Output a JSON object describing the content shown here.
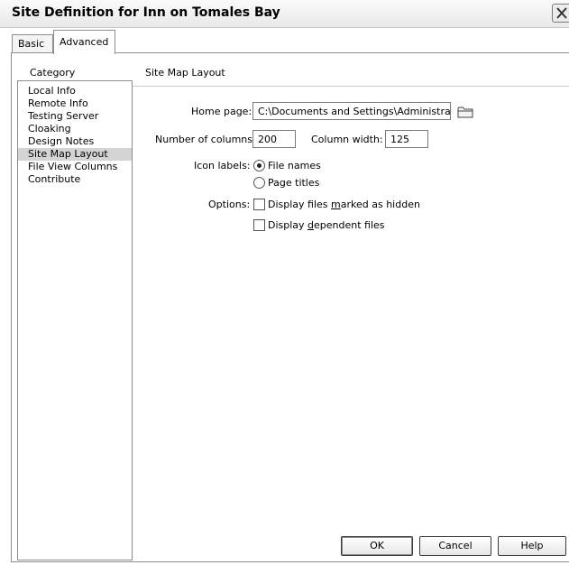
{
  "window": {
    "title": "Site Definition for Inn on Tomales Bay",
    "close_icon": "close-icon"
  },
  "tabs": [
    {
      "label": "Basic",
      "active": false
    },
    {
      "label": "Advanced",
      "active": true
    }
  ],
  "category": {
    "heading": "Category",
    "items": [
      {
        "label": "Local Info",
        "selected": false
      },
      {
        "label": "Remote Info",
        "selected": false
      },
      {
        "label": "Testing Server",
        "selected": false
      },
      {
        "label": "Cloaking",
        "selected": false
      },
      {
        "label": "Design Notes",
        "selected": false
      },
      {
        "label": "Site Map Layout",
        "selected": true
      },
      {
        "label": "File View Columns",
        "selected": false
      },
      {
        "label": "Contribute",
        "selected": false
      }
    ]
  },
  "section": {
    "heading": "Site Map Layout"
  },
  "form": {
    "home_page_label": "Home page:",
    "home_page_value": "C:\\Documents and Settings\\Administrat",
    "browse_icon": "folder-icon",
    "columns_label": "Number of columns:",
    "columns_value": "200",
    "column_width_label": "Column width:",
    "column_width_value": "125",
    "icon_labels_label": "Icon labels:",
    "icon_label_options": [
      {
        "label": "File names",
        "selected": true
      },
      {
        "label": "Page titles",
        "selected": false
      }
    ],
    "options_label": "Options:",
    "option_hidden_pre": "Display files ",
    "option_hidden_accel": "m",
    "option_hidden_post": "arked as hidden",
    "option_hidden_checked": false,
    "option_dependent_pre": "Display ",
    "option_dependent_accel": "d",
    "option_dependent_post": "ependent files",
    "option_dependent_checked": false
  },
  "buttons": {
    "ok": "OK",
    "cancel": "Cancel",
    "help": "Help"
  }
}
